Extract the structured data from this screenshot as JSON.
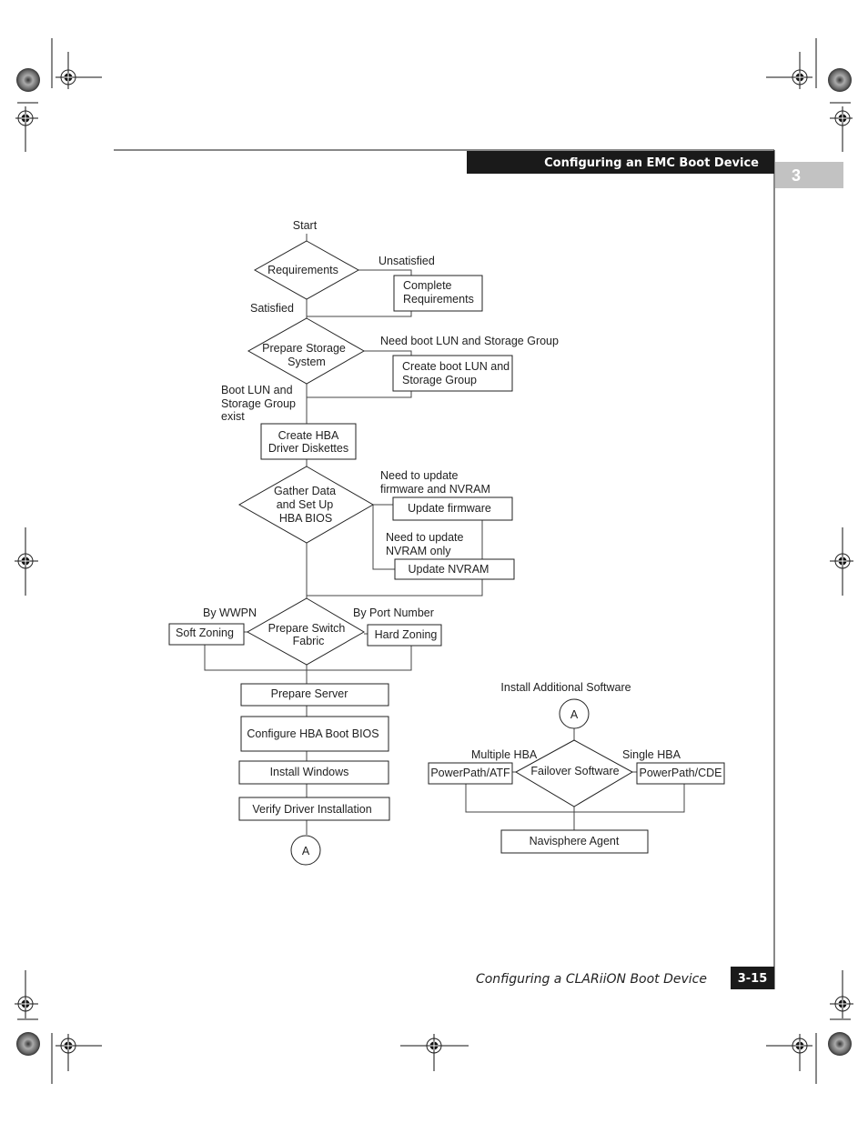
{
  "header": {
    "section_title": "Configuring an EMC Boot Device",
    "chapter_number": "3"
  },
  "footer": {
    "title": "Configuring a CLARiiON Boot Device",
    "page_number": "3-15"
  },
  "flowchart": {
    "start_label": "Start",
    "requirements": {
      "decision": "Requirements",
      "unsatisfied_label": "Unsatisfied",
      "satisfied_label": "Satisfied",
      "complete_box": [
        "Complete",
        "Requirements"
      ]
    },
    "storage": {
      "decision": [
        "Prepare Storage",
        "System"
      ],
      "need_label": "Need boot LUN and Storage Group",
      "create_box": [
        "Create boot LUN and",
        "Storage Group"
      ],
      "exist_label": [
        "Boot LUN and",
        "Storage Group",
        "exist"
      ]
    },
    "create_hba_box": [
      "Create HBA",
      "Driver Diskettes"
    ],
    "gather": {
      "decision": [
        "Gather Data",
        "and Set Up",
        "HBA BIOS"
      ],
      "fw_label": [
        "Need to update",
        "firmware and NVRAM"
      ],
      "fw_box": "Update firmware",
      "nvram_label": [
        "Need to update",
        "NVRAM only"
      ],
      "nvram_box": "Update NVRAM"
    },
    "switch": {
      "decision": [
        "Prepare Switch",
        "Fabric"
      ],
      "wwpn_label": "By WWPN",
      "port_label": "By Port Number",
      "soft_box": "Soft Zoning",
      "hard_box": "Hard Zoning"
    },
    "steps": [
      "Prepare Server",
      "Configure HBA Boot BIOS",
      "Install Windows",
      "Verify Driver Installation"
    ],
    "connector_label": "A",
    "additional": {
      "title": "Install Additional Software",
      "connector_label": "A",
      "decision": "Failover Software",
      "multiple_label": "Multiple HBA",
      "single_label": "Single HBA",
      "atf_box": "PowerPath/ATF",
      "cde_box": "PowerPath/CDE",
      "agent_box": "Navisphere Agent"
    }
  }
}
